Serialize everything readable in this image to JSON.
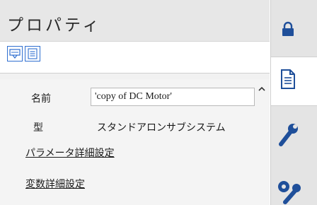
{
  "panel": {
    "title": "プロパティ"
  },
  "toolbar": {
    "buttons": [
      {
        "icon": "display-view-icon"
      },
      {
        "icon": "list-view-icon"
      }
    ]
  },
  "properties": {
    "name_label": "名前",
    "name_value": "'copy of DC Motor'",
    "type_label": "型",
    "type_value": "スタンドアロンサブシステム",
    "links": [
      "パラメータ詳細設定",
      "変数詳細設定"
    ]
  },
  "side_tabs": [
    {
      "icon": "lock-icon",
      "active": false
    },
    {
      "icon": "document-icon",
      "active": true
    },
    {
      "icon": "wrench-icon",
      "active": false
    },
    {
      "icon": "settings-wrench-icon",
      "active": false
    }
  ],
  "colors": {
    "accent": "#2f6fd0",
    "header_bg": "#e7e7e7",
    "panel_bg": "#f4f4f4"
  }
}
